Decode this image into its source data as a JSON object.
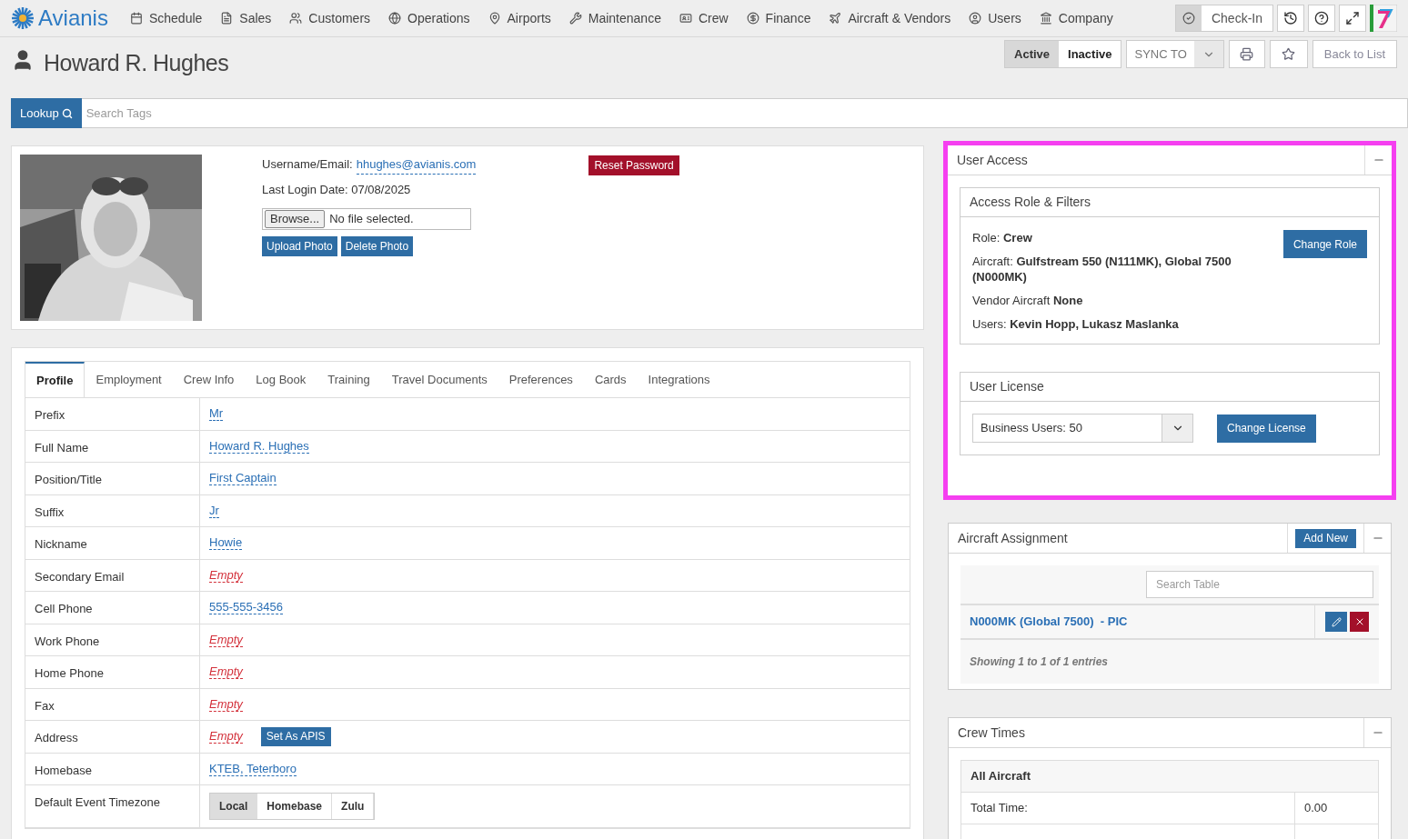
{
  "nav": {
    "brand": "Avianis",
    "items": [
      "Schedule",
      "Sales",
      "Customers",
      "Operations",
      "Airports",
      "Maintenance",
      "Crew",
      "Finance",
      "Aircraft & Vendors",
      "Users",
      "Company"
    ],
    "check_in": "Check-In"
  },
  "header": {
    "title": "Howard R. Hughes",
    "status": [
      {
        "label": "Active",
        "selected": true
      },
      {
        "label": "Inactive",
        "selected": false
      }
    ],
    "sync": "SYNC TO",
    "back": "Back to List"
  },
  "search": {
    "button": "Lookup",
    "placeholder": "Search Tags"
  },
  "profile": {
    "username_label": "Username/Email:",
    "username": "hhughes@avianis.com",
    "last_login": "Last Login Date: 07/08/2025",
    "reset": "Reset Password",
    "browse": "Browse...",
    "file": "No file selected.",
    "upload": "Upload Photo",
    "delete": "Delete Photo"
  },
  "tabs": [
    {
      "label": "Profile",
      "selected": true
    },
    {
      "label": "Employment",
      "selected": false
    },
    {
      "label": "Crew Info",
      "selected": false
    },
    {
      "label": "Log Book",
      "selected": false
    },
    {
      "label": "Training",
      "selected": false
    },
    {
      "label": "Travel Documents",
      "selected": false
    },
    {
      "label": "Preferences",
      "selected": false
    },
    {
      "label": "Cards",
      "selected": false
    },
    {
      "label": "Integrations",
      "selected": false
    }
  ],
  "fields": [
    {
      "label": "Prefix",
      "kind": "link",
      "value": "Mr"
    },
    {
      "label": "Full Name",
      "kind": "link",
      "value": "Howard R. Hughes"
    },
    {
      "label": "Position/Title",
      "kind": "link",
      "value": "First Captain"
    },
    {
      "label": "Suffix",
      "kind": "link",
      "value": "Jr"
    },
    {
      "label": "Nickname",
      "kind": "link",
      "value": "Howie"
    },
    {
      "label": "Secondary Email",
      "kind": "empty",
      "value": "Empty"
    },
    {
      "label": "Cell Phone",
      "kind": "link",
      "value": "555-555-3456"
    },
    {
      "label": "Work Phone",
      "kind": "empty",
      "value": "Empty"
    },
    {
      "label": "Home Phone",
      "kind": "empty",
      "value": "Empty"
    },
    {
      "label": "Fax",
      "kind": "empty",
      "value": "Empty"
    },
    {
      "label": "Address",
      "kind": "empty",
      "value": "Empty",
      "action": "Set As APIS"
    },
    {
      "label": "Homebase",
      "kind": "link",
      "value": "KTEB, Teterboro"
    },
    {
      "label": "Default Event Timezone",
      "kind": "toggle",
      "options": [
        {
          "label": "Local",
          "selected": true
        },
        {
          "label": "Homebase",
          "selected": false
        },
        {
          "label": "Zulu",
          "selected": false
        }
      ]
    }
  ],
  "user_access": {
    "title": "User Access",
    "role_title": "Access Role & Filters",
    "lines": [
      "Role: **Crew**",
      "Aircraft: **Gulfstream 550 (N111MK), Global 7500 (N000MK)**",
      "Vendor Aircraft **None**",
      "Users: **Kevin Hopp, Lukasz Maslanka**"
    ],
    "change_role": "Change Role",
    "license_title": "User License",
    "license": "Business Users: 50",
    "change_license": "Change License"
  },
  "aircraft_assignment": {
    "title": "Aircraft Assignment",
    "add": "Add New",
    "search_placeholder": "Search Table",
    "rows": [
      "N000MK (Global 7500)  - PIC"
    ],
    "footer": "Showing 1 to 1 of 1 entries"
  },
  "crew_times": {
    "title": "Crew Times",
    "group": "All Aircraft",
    "rows": [
      {
        "label": "Total Time:",
        "value": "0.00"
      }
    ]
  }
}
